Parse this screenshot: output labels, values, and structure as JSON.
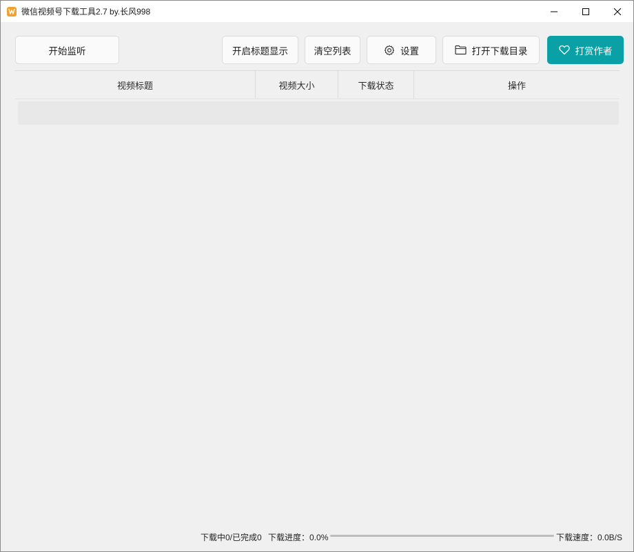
{
  "window": {
    "title": "微信视频号下载工具2.7 by.长风998",
    "icon": "app-logo-icon",
    "controls": [
      "minimize-icon",
      "maximize-icon",
      "close-icon"
    ]
  },
  "toolbar": {
    "start_listen_label": "开始监听",
    "title_display_label": "开启标题显示",
    "clear_list_label": "清空列表",
    "settings_label": "设置",
    "settings_icon": "gear-icon",
    "open_dir_label": "打开下载目录",
    "open_dir_icon": "folder-icon",
    "reward_label": "打赏作者",
    "reward_icon": "heart-icon"
  },
  "table": {
    "columns": [
      "视频标题",
      "视频大小",
      "下载状态",
      "操作"
    ],
    "rows": []
  },
  "status": {
    "downloading_text": "下载中0/已完成0",
    "progress_label": "下载进度：",
    "progress_value": "0.0%",
    "progress_fraction": 0.0,
    "speed_label": "下载速度：",
    "speed_value": "0.0B/S"
  },
  "colors": {
    "accent": "#0aa1a6",
    "window_bg": "#f0f0f0",
    "app_icon": "#f2a12e"
  }
}
